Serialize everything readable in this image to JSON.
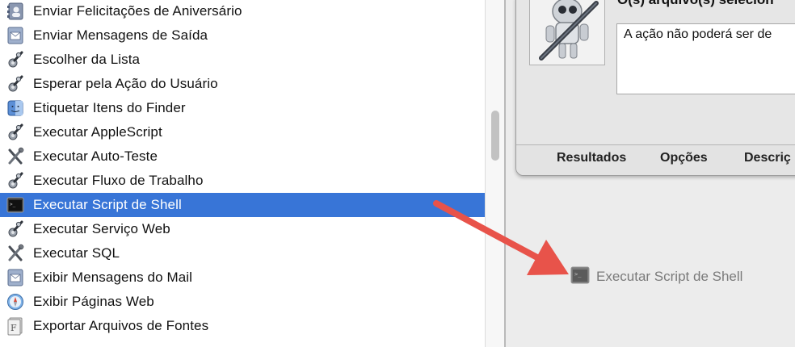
{
  "action_list": {
    "items": [
      {
        "label": "Enviar Felicitações de Aniversário",
        "icon": "address-book-icon"
      },
      {
        "label": "Enviar Mensagens de Saída",
        "icon": "mail-icon"
      },
      {
        "label": "Escolher da Lista",
        "icon": "automator-gear-icon"
      },
      {
        "label": "Esperar pela Ação do Usuário",
        "icon": "automator-gear-icon"
      },
      {
        "label": "Etiquetar Itens do Finder",
        "icon": "finder-icon"
      },
      {
        "label": "Executar AppleScript",
        "icon": "automator-gear-icon"
      },
      {
        "label": "Executar Auto-Teste",
        "icon": "tools-icon"
      },
      {
        "label": "Executar Fluxo de Trabalho",
        "icon": "automator-gear-icon"
      },
      {
        "label": "Executar Script de Shell",
        "icon": "terminal-icon",
        "selected": true
      },
      {
        "label": "Executar Serviço Web",
        "icon": "automator-gear-icon"
      },
      {
        "label": "Executar SQL",
        "icon": "tools-icon"
      },
      {
        "label": "Exibir Mensagens do Mail",
        "icon": "mail-icon"
      },
      {
        "label": "Exibir Páginas Web",
        "icon": "safari-icon"
      },
      {
        "label": "Exportar Arquivos de Fontes",
        "icon": "font-book-icon"
      }
    ]
  },
  "action_card": {
    "title": "O(s) arquivo(s) selecion",
    "description": "A ação não poderá ser de",
    "tabs": [
      "Resultados",
      "Opções",
      "Descriç"
    ]
  },
  "drag_item": {
    "label": "Executar Script de Shell",
    "icon": "terminal-icon"
  },
  "colors": {
    "selection": "#3875d7",
    "arrow": "#e8534a"
  }
}
